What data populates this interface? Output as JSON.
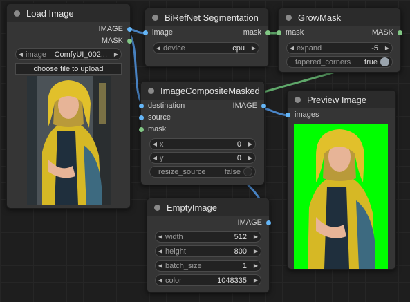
{
  "colors": {
    "image_port": "#64b5f6",
    "mask_port": "#81c784",
    "canvas_bg": "#1e1e1e",
    "preview_bg": "#00ff00"
  },
  "nodes": {
    "load_image": {
      "title": "Load Image",
      "outputs": [
        "IMAGE",
        "MASK"
      ],
      "image_widget": {
        "label": "image",
        "value": "ComfyUI_002..."
      },
      "upload_label": "choose file to upload"
    },
    "birefnet": {
      "title": "BiRefNet Segmentation",
      "input": "image",
      "output": "mask",
      "device": {
        "label": "device",
        "value": "cpu"
      }
    },
    "growmask": {
      "title": "GrowMask",
      "input": "mask",
      "output": "MASK",
      "expand": {
        "label": "expand",
        "value": "-5"
      },
      "tapered": {
        "label": "tapered_corners",
        "value": "true"
      }
    },
    "composite": {
      "title": "ImageCompositeMasked",
      "inputs": [
        "destination",
        "source",
        "mask"
      ],
      "output": "IMAGE",
      "x": {
        "label": "x",
        "value": "0"
      },
      "y": {
        "label": "y",
        "value": "0"
      },
      "resize": {
        "label": "resize_source",
        "value": "false"
      }
    },
    "preview": {
      "title": "Preview Image",
      "input": "images"
    },
    "empty": {
      "title": "EmptyImage",
      "output": "IMAGE",
      "width": {
        "label": "width",
        "value": "512"
      },
      "height": {
        "label": "height",
        "value": "800"
      },
      "batch": {
        "label": "batch_size",
        "value": "1"
      },
      "color": {
        "label": "color",
        "value": "1048335"
      }
    }
  }
}
